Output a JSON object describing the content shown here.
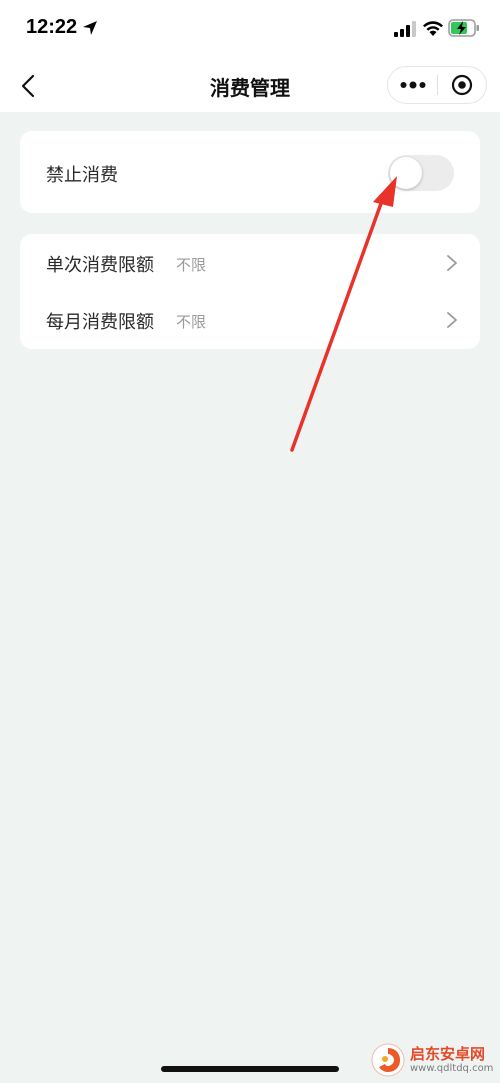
{
  "status_bar": {
    "time": "12:22",
    "icons": [
      "location-icon",
      "signal-icon",
      "wifi-icon",
      "battery-charging-icon"
    ]
  },
  "nav": {
    "title": "消费管理",
    "back_icon": "chevron-left-icon",
    "more_icon": "more-dots-icon",
    "close_icon": "target-circle-icon"
  },
  "settings": {
    "forbid": {
      "label": "禁止消费",
      "enabled": false
    },
    "limits": [
      {
        "label": "单次消费限额",
        "value": "不限"
      },
      {
        "label": "每月消费限额",
        "value": "不限"
      }
    ]
  },
  "watermark": {
    "title": "启东安卓网",
    "url": "www.qdltdq.com"
  },
  "colors": {
    "page_background": "#eff4f3",
    "card_background": "#ffffff",
    "toggle_off": "#ececec",
    "annotation_arrow": "#e8322a",
    "secondary_text": "#9a9a9a"
  }
}
